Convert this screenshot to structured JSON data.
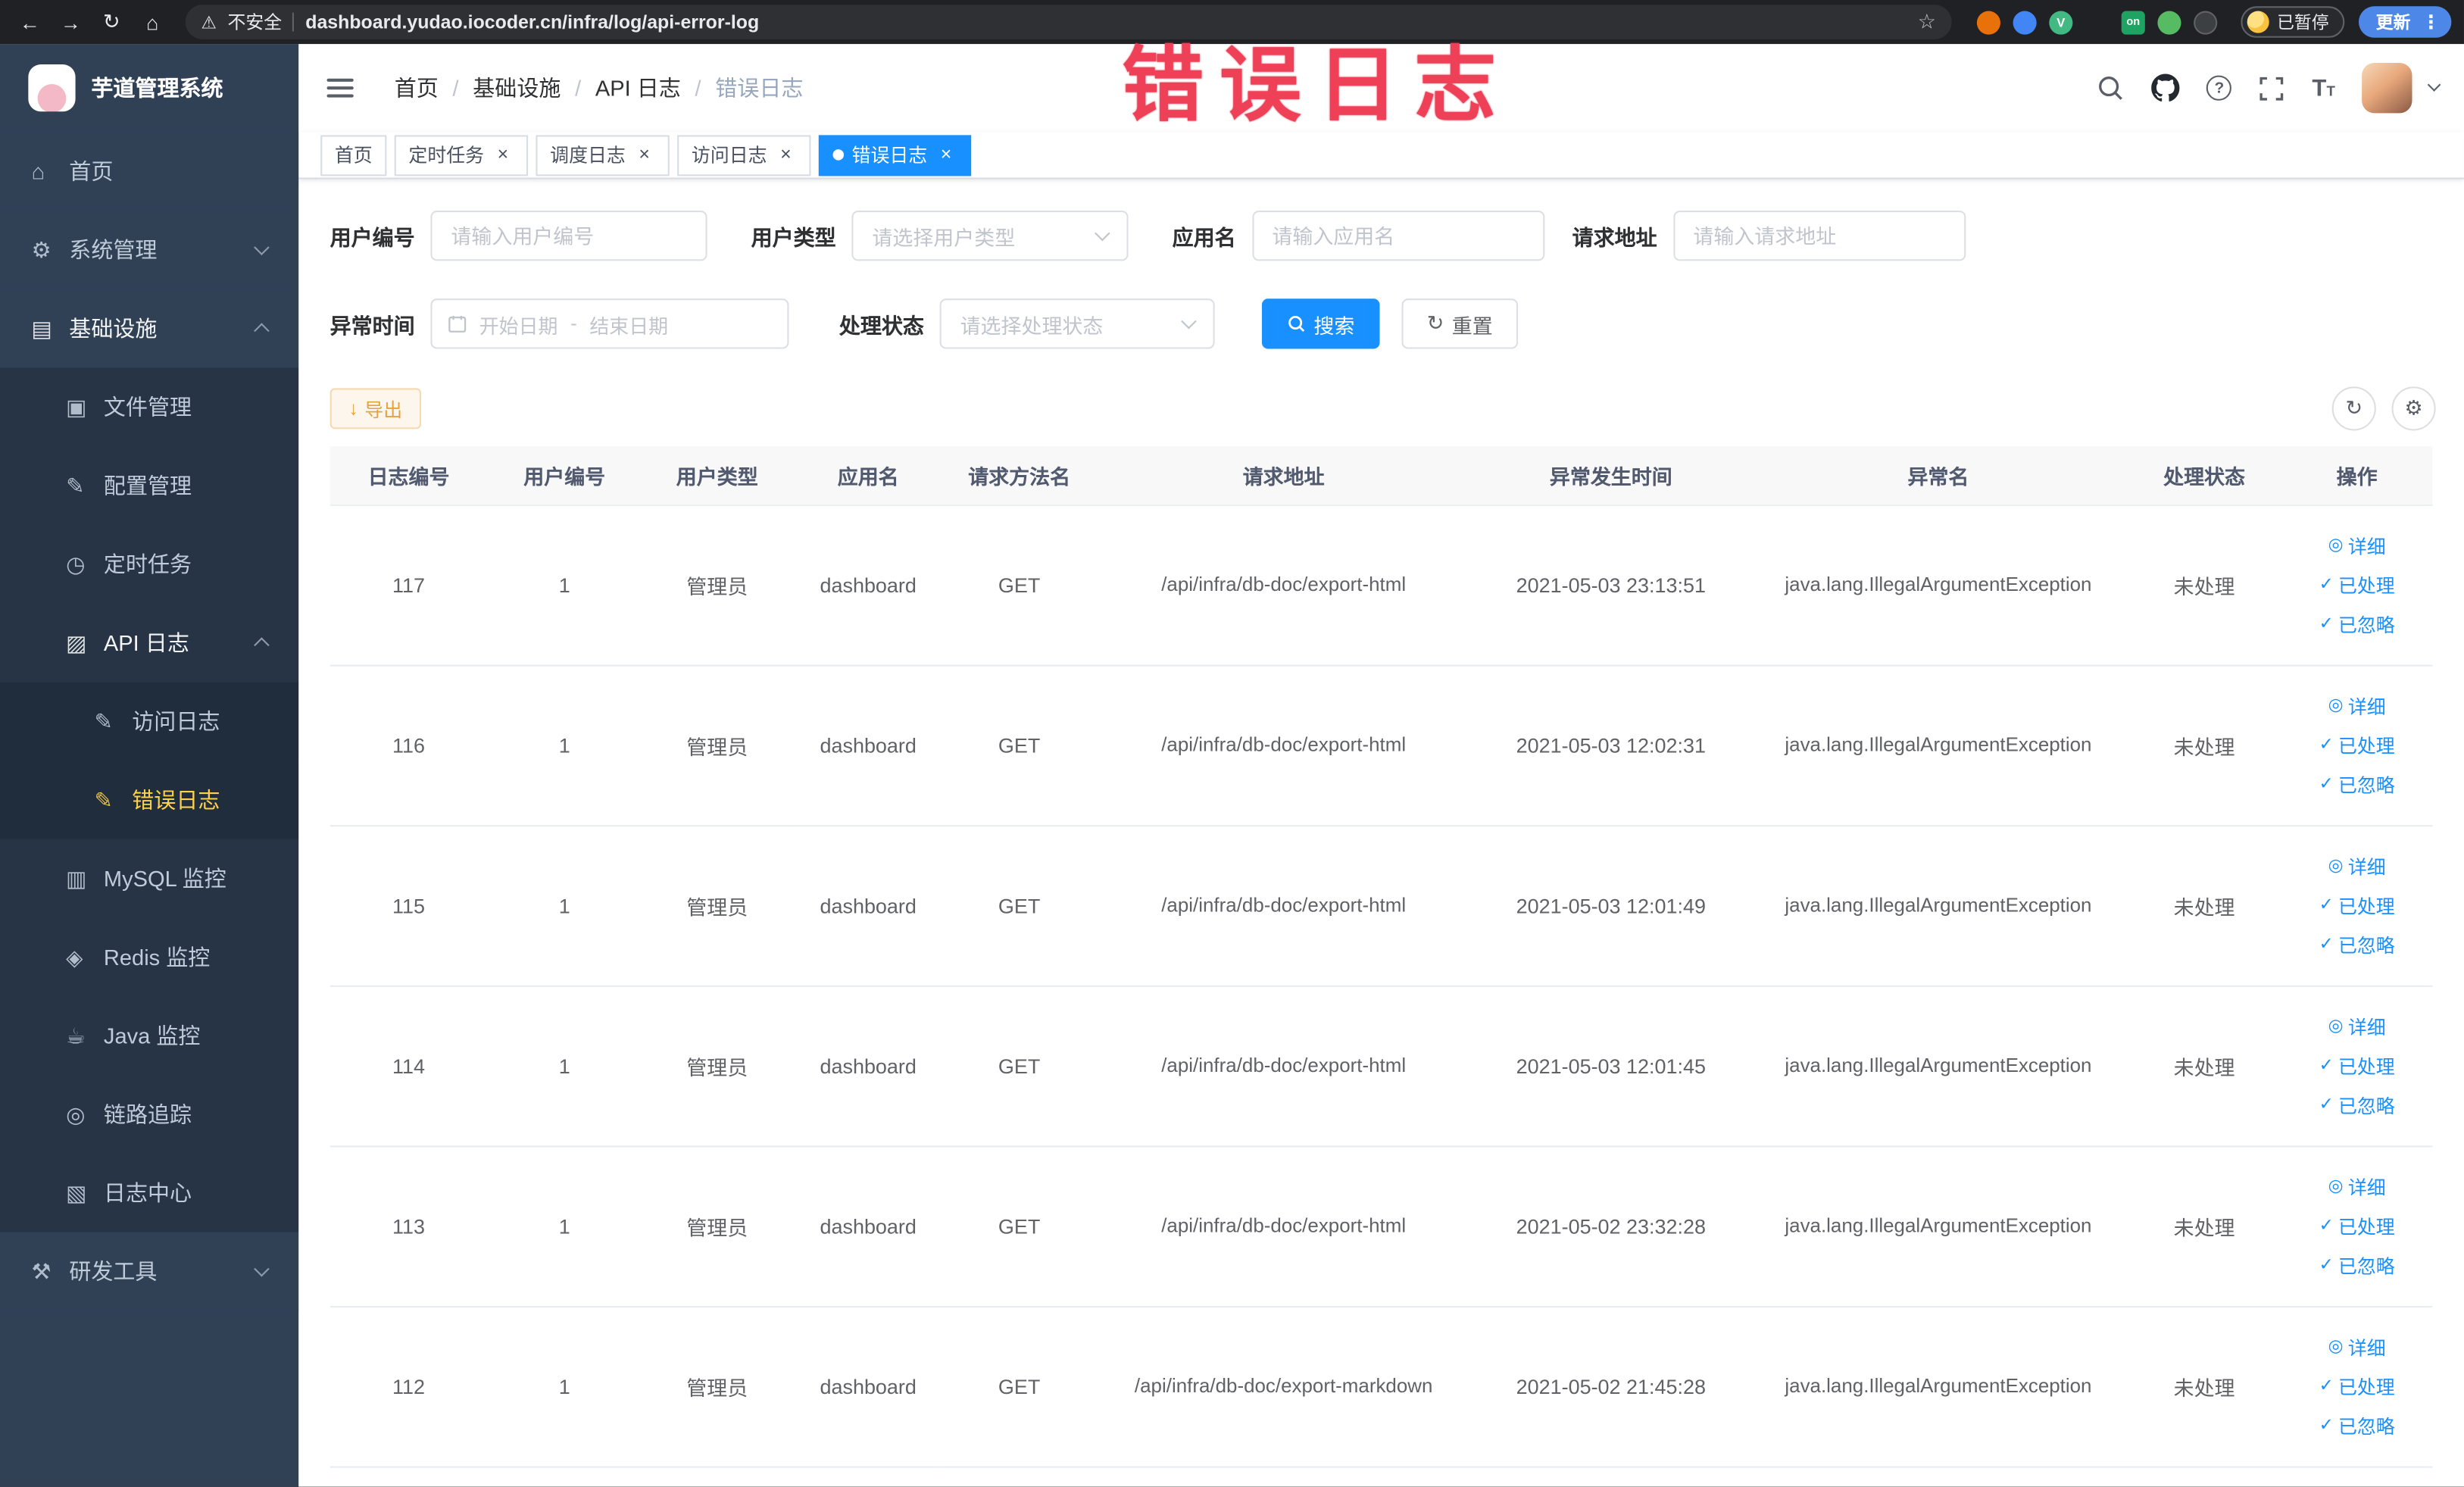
{
  "browser": {
    "security_label": "不安全",
    "url": "dashboard.yudao.iocoder.cn/infra/log/api-error-log",
    "paused_label": "已暂停",
    "update_label": "更新"
  },
  "annotation": {
    "text": "错误日志"
  },
  "sidebar": {
    "logo_title": "芋道管理系统",
    "items": [
      {
        "key": "home",
        "label": "首页",
        "level": 1,
        "icon": "home-icon"
      },
      {
        "key": "system-mgmt",
        "label": "系统管理",
        "level": 1,
        "icon": "gear-icon",
        "chevron": "down"
      },
      {
        "key": "infrastructure",
        "label": "基础设施",
        "level": 1,
        "icon": "infra-icon",
        "chevron": "up",
        "open": true
      },
      {
        "key": "file-mgmt",
        "label": "文件管理",
        "level": 2,
        "icon": "file-icon"
      },
      {
        "key": "config-mgmt",
        "label": "配置管理",
        "level": 2,
        "icon": "config-icon"
      },
      {
        "key": "scheduled-jobs",
        "label": "定时任务",
        "level": 2,
        "icon": "timer-icon"
      },
      {
        "key": "api-log",
        "label": "API 日志",
        "level": 2,
        "icon": "api-log-icon",
        "chevron": "up",
        "open": true
      },
      {
        "key": "access-log",
        "label": "访问日志",
        "level": 3,
        "icon": "edit-square-icon"
      },
      {
        "key": "error-log",
        "label": "错误日志",
        "level": 3,
        "icon": "edit-square-icon",
        "active": true
      },
      {
        "key": "mysql-monitor",
        "label": "MySQL 监控",
        "level": 2,
        "icon": "mysql-icon"
      },
      {
        "key": "redis-monitor",
        "label": "Redis 监控",
        "level": 2,
        "icon": "redis-icon"
      },
      {
        "key": "java-monitor",
        "label": "Java 监控",
        "level": 2,
        "icon": "java-icon"
      },
      {
        "key": "trace",
        "label": "链路追踪",
        "level": 2,
        "icon": "trace-icon"
      },
      {
        "key": "log-center",
        "label": "日志中心",
        "level": 2,
        "icon": "log-center-icon"
      },
      {
        "key": "dev-tools",
        "label": "研发工具",
        "level": 1,
        "icon": "devtools-icon",
        "chevron": "down"
      }
    ]
  },
  "header": {
    "breadcrumb": [
      "首页",
      "基础设施",
      "API 日志",
      "错误日志"
    ],
    "separator": "/"
  },
  "tabs": [
    {
      "key": "home",
      "label": "首页",
      "closable": false,
      "active": false
    },
    {
      "key": "scheduled-jobs",
      "label": "定时任务",
      "closable": true,
      "active": false
    },
    {
      "key": "schedule-log",
      "label": "调度日志",
      "closable": true,
      "active": false
    },
    {
      "key": "access-log",
      "label": "访问日志",
      "closable": true,
      "active": false
    },
    {
      "key": "error-log",
      "label": "错误日志",
      "closable": true,
      "active": true
    }
  ],
  "filters": {
    "user_id": {
      "label": "用户编号",
      "placeholder": "请输入用户编号"
    },
    "user_type": {
      "label": "用户类型",
      "placeholder": "请选择用户类型"
    },
    "app_name": {
      "label": "应用名",
      "placeholder": "请输入应用名"
    },
    "request_url": {
      "label": "请求地址",
      "placeholder": "请输入请求地址"
    },
    "exception_time": {
      "label": "异常时间",
      "start_placeholder": "开始日期",
      "separator": "-",
      "end_placeholder": "结束日期"
    },
    "process_status": {
      "label": "处理状态",
      "placeholder": "请选择处理状态"
    },
    "search_label": "搜索",
    "reset_label": "重置"
  },
  "toolbar": {
    "export_label": "导出"
  },
  "table": {
    "columns": [
      "日志编号",
      "用户编号",
      "用户类型",
      "应用名",
      "请求方法名",
      "请求地址",
      "异常发生时间",
      "异常名",
      "处理状态",
      "操作"
    ],
    "actions": [
      {
        "key": "detail",
        "label": "详细",
        "icon": "eye-icon"
      },
      {
        "key": "processed",
        "label": "已处理",
        "icon": "check-icon"
      },
      {
        "key": "ignored",
        "label": "已忽略",
        "icon": "check-icon"
      }
    ],
    "rows": [
      {
        "id": "117",
        "user_id": "1",
        "user_type": "管理员",
        "app": "dashboard",
        "method": "GET",
        "url": "/api/infra/db-doc/export-html",
        "time": "2021-05-03 23:13:51",
        "exception": "java.lang.IllegalArgumentException",
        "status": "未处理"
      },
      {
        "id": "116",
        "user_id": "1",
        "user_type": "管理员",
        "app": "dashboard",
        "method": "GET",
        "url": "/api/infra/db-doc/export-html",
        "time": "2021-05-03 12:02:31",
        "exception": "java.lang.IllegalArgumentException",
        "status": "未处理"
      },
      {
        "id": "115",
        "user_id": "1",
        "user_type": "管理员",
        "app": "dashboard",
        "method": "GET",
        "url": "/api/infra/db-doc/export-html",
        "time": "2021-05-03 12:01:49",
        "exception": "java.lang.IllegalArgumentException",
        "status": "未处理"
      },
      {
        "id": "114",
        "user_id": "1",
        "user_type": "管理员",
        "app": "dashboard",
        "method": "GET",
        "url": "/api/infra/db-doc/export-html",
        "time": "2021-05-03 12:01:45",
        "exception": "java.lang.IllegalArgumentException",
        "status": "未处理"
      },
      {
        "id": "113",
        "user_id": "1",
        "user_type": "管理员",
        "app": "dashboard",
        "method": "GET",
        "url": "/api/infra/db-doc/export-html",
        "time": "2021-05-02 23:32:28",
        "exception": "java.lang.IllegalArgumentException",
        "status": "未处理"
      },
      {
        "id": "112",
        "user_id": "1",
        "user_type": "管理员",
        "app": "dashboard",
        "method": "GET",
        "url": "/api/infra/db-doc/export-markdown",
        "time": "2021-05-02 21:45:28",
        "exception": "java.lang.IllegalArgumentException",
        "status": "未处理"
      }
    ]
  },
  "icons": {
    "home-icon": "⌂",
    "gear-icon": "⚙",
    "infra-icon": "▤",
    "file-icon": "▣",
    "config-icon": "✎",
    "timer-icon": "◷",
    "api-log-icon": "▨",
    "edit-square-icon": "✎",
    "mysql-icon": "▥",
    "redis-icon": "◈",
    "java-icon": "☕",
    "trace-icon": "◎",
    "log-center-icon": "▧",
    "devtools-icon": "⚒",
    "eye-icon": "◎",
    "check-icon": "✓",
    "close-icon": "×",
    "back-icon": "←",
    "forward-icon": "→",
    "reload-icon": "↻",
    "chrome-home-icon": "⌂",
    "warning-icon": "⚠",
    "star-icon": "☆",
    "kebab-icon": "⋮",
    "question-icon": "?",
    "fontsize-icon": "T",
    "download-icon": "↓",
    "refresh-icon": "↻",
    "settings-icon": "⚙",
    "ext-v": "V",
    "ext-on": "on"
  }
}
